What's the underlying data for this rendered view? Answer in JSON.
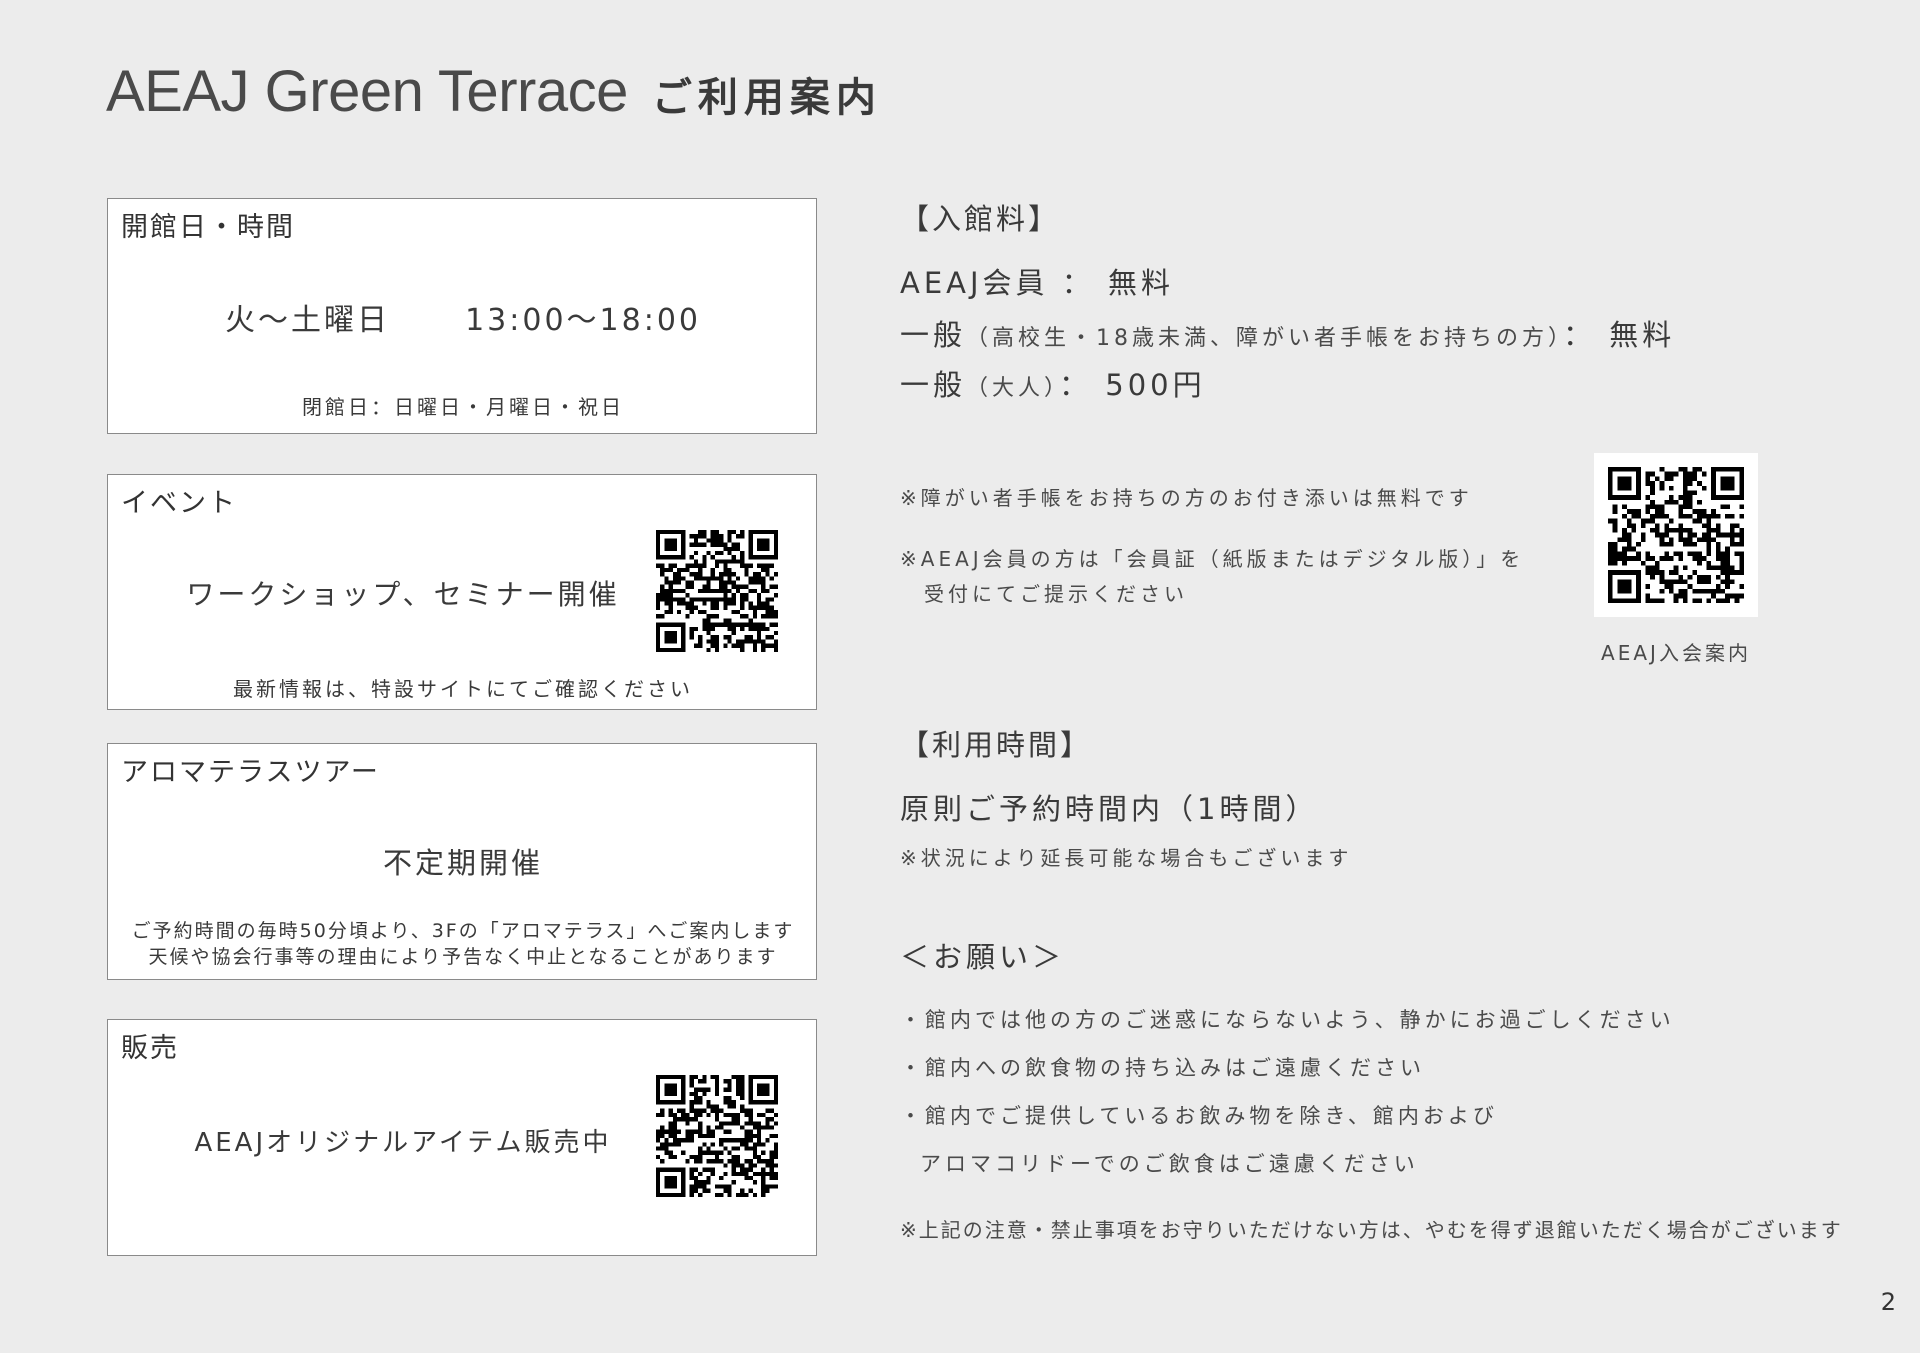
{
  "title": {
    "main": "AEAJ Green Terrace",
    "sub": "ご利用案内"
  },
  "hours": {
    "label": "開館日・時間",
    "days": "火～土曜日",
    "time": "13:00～18:00",
    "closed": "閉館日：日曜日・月曜日・祝日"
  },
  "event": {
    "label": "イベント",
    "main": "ワークショップ、セミナー開催",
    "note": "最新情報は、特設サイトにてご確認ください"
  },
  "tour": {
    "label": "アロマテラスツアー",
    "main": "不定期開催",
    "note1": "ご予約時間の毎時50分頃より、3Fの「アロマテラス」へご案内します",
    "note2": "天候や協会行事等の理由により予告なく中止となることがあります"
  },
  "sales": {
    "label": "販売",
    "main": "AEAJオリジナルアイテム販売中"
  },
  "fee": {
    "heading": "【入館料】",
    "member": "AEAJ会員 ： 無料",
    "general_student_prefix": "一般",
    "general_student_detail": "（高校生・18歳未満、障がい者手帳をお持ちの方）",
    "general_student_price": "： 無料",
    "general_adult_prefix": "一般",
    "general_adult_detail": "（大人）",
    "general_adult_price": "： 500円",
    "note1": "※障がい者手帳をお持ちの方のお付き添いは無料です",
    "note2a": "※AEAJ会員の方は「会員証（紙版またはデジタル版）」を",
    "note2b": "受付にてご提示ください",
    "qr_caption": "AEAJ入会案内"
  },
  "usage": {
    "heading": "【利用時間】",
    "main": "原則ご予約時間内（1時間）",
    "note": "※状況により延長可能な場合もございます"
  },
  "request": {
    "heading": "＜お願い＞",
    "items": [
      "・館内では他の方のご迷惑にならないよう、静かにお過ごしください",
      "・館内への飲食物の持ち込みはご遠慮ください",
      "・館内でご提供しているお飲み物を除き、館内および",
      "アロマコリドーでのご飲食はご遠慮ください"
    ],
    "warning": "※上記の注意・禁止事項をお守りいただけない方は、やむを得ず退館いただく場合がございます"
  },
  "page_number": "2"
}
